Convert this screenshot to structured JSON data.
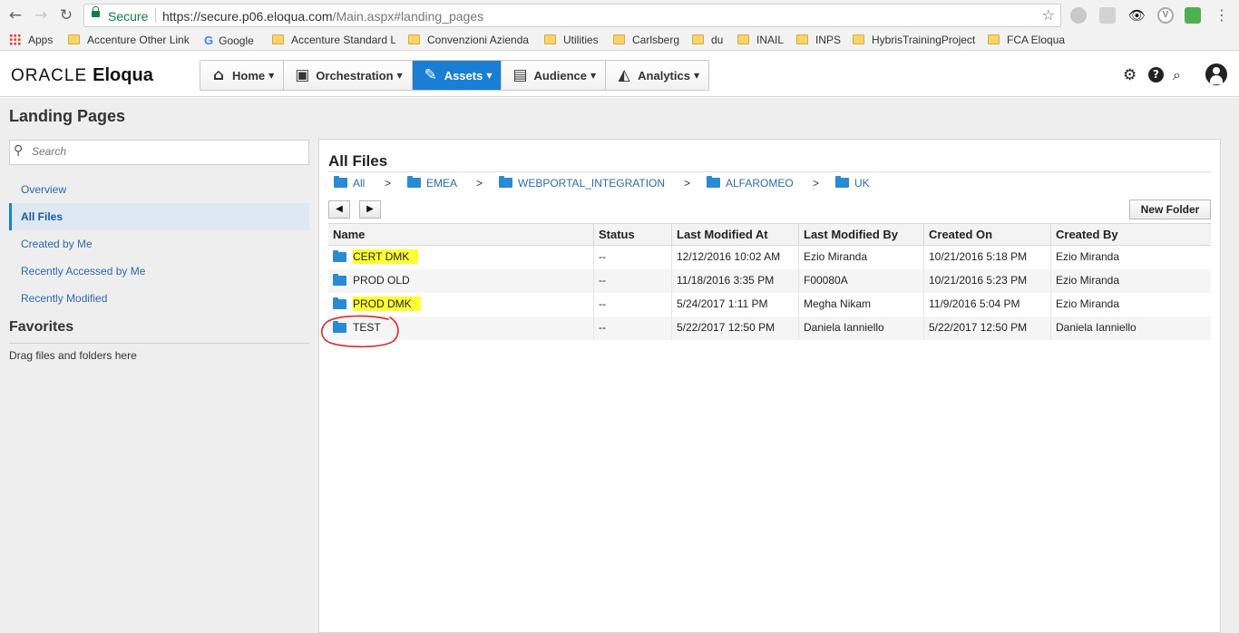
{
  "browser": {
    "secure_label": "Secure",
    "url_host": "https://secure.p06.eloqua.com",
    "url_path": "/Main.aspx#landing_pages",
    "bookmarks": [
      {
        "label": "Apps"
      },
      {
        "label": "Accenture Other Link"
      },
      {
        "label": "Google"
      },
      {
        "label": "Accenture Standard L"
      },
      {
        "label": "Convenzioni Azienda"
      },
      {
        "label": "Utilities"
      },
      {
        "label": "Carlsberg"
      },
      {
        "label": "du"
      },
      {
        "label": "INAIL"
      },
      {
        "label": "INPS"
      },
      {
        "label": "HybrisTrainingProject"
      },
      {
        "label": "FCA Eloqua"
      }
    ]
  },
  "header": {
    "logo_oracle": "ORACLE",
    "logo_eloqua": "Eloqua",
    "nav": [
      {
        "label": "Home",
        "icon": "home-icon"
      },
      {
        "label": "Orchestration",
        "icon": "orchestration-icon"
      },
      {
        "label": "Assets",
        "icon": "assets-icon",
        "active": true
      },
      {
        "label": "Audience",
        "icon": "audience-icon"
      },
      {
        "label": "Analytics",
        "icon": "analytics-icon"
      }
    ]
  },
  "page": {
    "title": "Landing Pages"
  },
  "sidebar": {
    "search_placeholder": "Search",
    "items": [
      {
        "label": "Overview"
      },
      {
        "label": "All Files",
        "active": true
      },
      {
        "label": "Created by Me"
      },
      {
        "label": "Recently Accessed by Me"
      },
      {
        "label": "Recently Modified"
      }
    ],
    "favorites_title": "Favorites",
    "favorites_hint": "Drag files and folders here"
  },
  "main": {
    "title": "All Files",
    "breadcrumb": [
      "All",
      "EMEA",
      "WEBPORTAL_INTEGRATION",
      "ALFAROMEO",
      "UK"
    ],
    "breadcrumb_sep": ">",
    "new_folder_label": "New Folder",
    "columns": [
      "Name",
      "Status",
      "Last Modified At",
      "Last Modified By",
      "Created On",
      "Created By"
    ],
    "rows": [
      {
        "name": "CERT DMK",
        "status": "--",
        "modified_at": "12/12/2016 10:02 AM",
        "modified_by": "Ezio Miranda",
        "created_on": "10/21/2016 5:18 PM",
        "created_by": "Ezio Miranda",
        "highlighted": true
      },
      {
        "name": "PROD OLD",
        "status": "--",
        "modified_at": "11/18/2016 3:35 PM",
        "modified_by": "F00080A",
        "created_on": "10/21/2016 5:23 PM",
        "created_by": "Ezio Miranda",
        "highlighted": false
      },
      {
        "name": "PROD DMK",
        "status": "--",
        "modified_at": "5/24/2017 1:11 PM",
        "modified_by": "Megha Nikam",
        "created_on": "11/9/2016 5:04 PM",
        "created_by": "Ezio Miranda",
        "highlighted": true
      },
      {
        "name": "TEST",
        "status": "--",
        "modified_at": "5/22/2017 12:50 PM",
        "modified_by": "Daniela Ianniello",
        "created_on": "5/22/2017 12:50 PM",
        "created_by": "Daniela Ianniello",
        "highlighted": false
      }
    ]
  },
  "colors": {
    "accent": "#1a7fd4",
    "link": "#2a6ab2",
    "highlight": "#ffff33",
    "annotation": "#d9262c",
    "secure": "#0b8043"
  }
}
